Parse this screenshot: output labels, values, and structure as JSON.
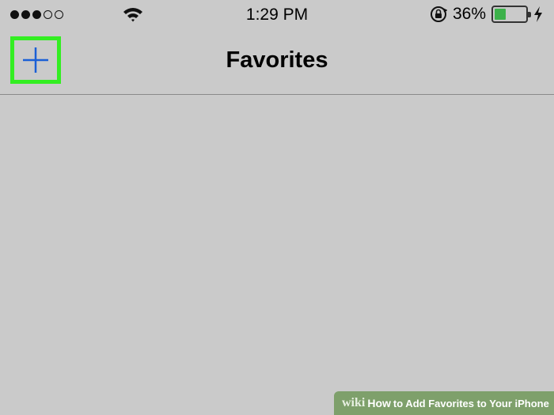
{
  "status_bar": {
    "time": "1:29 PM",
    "battery_percent": "36%",
    "battery_level": 0.36,
    "signal_bars_filled": 3,
    "signal_bars_total": 5
  },
  "nav": {
    "title": "Favorites",
    "add_icon": "plus-icon",
    "highlight_color": "#33ee22",
    "accent_color": "#1a5fd6"
  },
  "watermark": {
    "brand": "wiki",
    "how": "How",
    "rest": "to Add Favorites to Your iPhone"
  }
}
